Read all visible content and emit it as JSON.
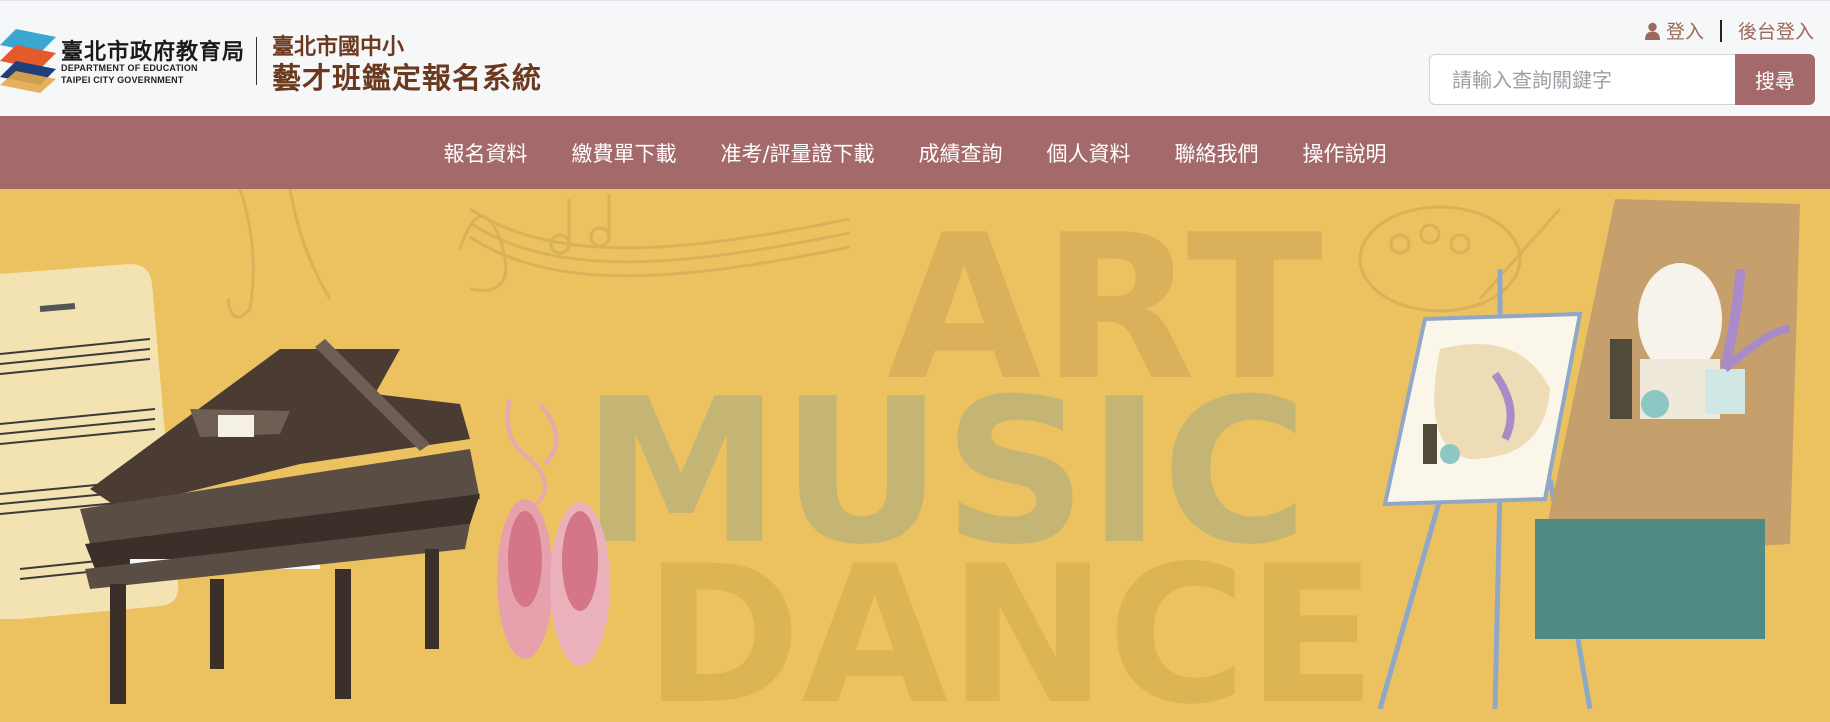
{
  "header": {
    "org_name_zh": "臺北市政府教育局",
    "org_name_en_line1": "DEPARTMENT OF EDUCATION",
    "org_name_en_line2": "TAIPEI CITY GOVERNMENT",
    "system_subtitle": "臺北市國中小",
    "system_title": "藝才班鑑定報名系統",
    "login_label": "登入",
    "admin_login_label": "後台登入",
    "search_placeholder": "請輸入查詢關鍵字",
    "search_button_label": "搜尋"
  },
  "nav": {
    "items": [
      {
        "label": "報名資料"
      },
      {
        "label": "繳費單下載"
      },
      {
        "label": "准考/評量證下載"
      },
      {
        "label": "成績查詢"
      },
      {
        "label": "個人資料"
      },
      {
        "label": "聯絡我們"
      },
      {
        "label": "操作說明"
      }
    ]
  },
  "banner": {
    "line1": "ART",
    "line2": "MUSIC",
    "line3": "DANCE"
  },
  "colors": {
    "accent": "#a4696a",
    "title_brown": "#6b3a1e",
    "banner_bg": "#ebc25f"
  },
  "icons": [
    "department-logo-icon",
    "user-icon"
  ]
}
